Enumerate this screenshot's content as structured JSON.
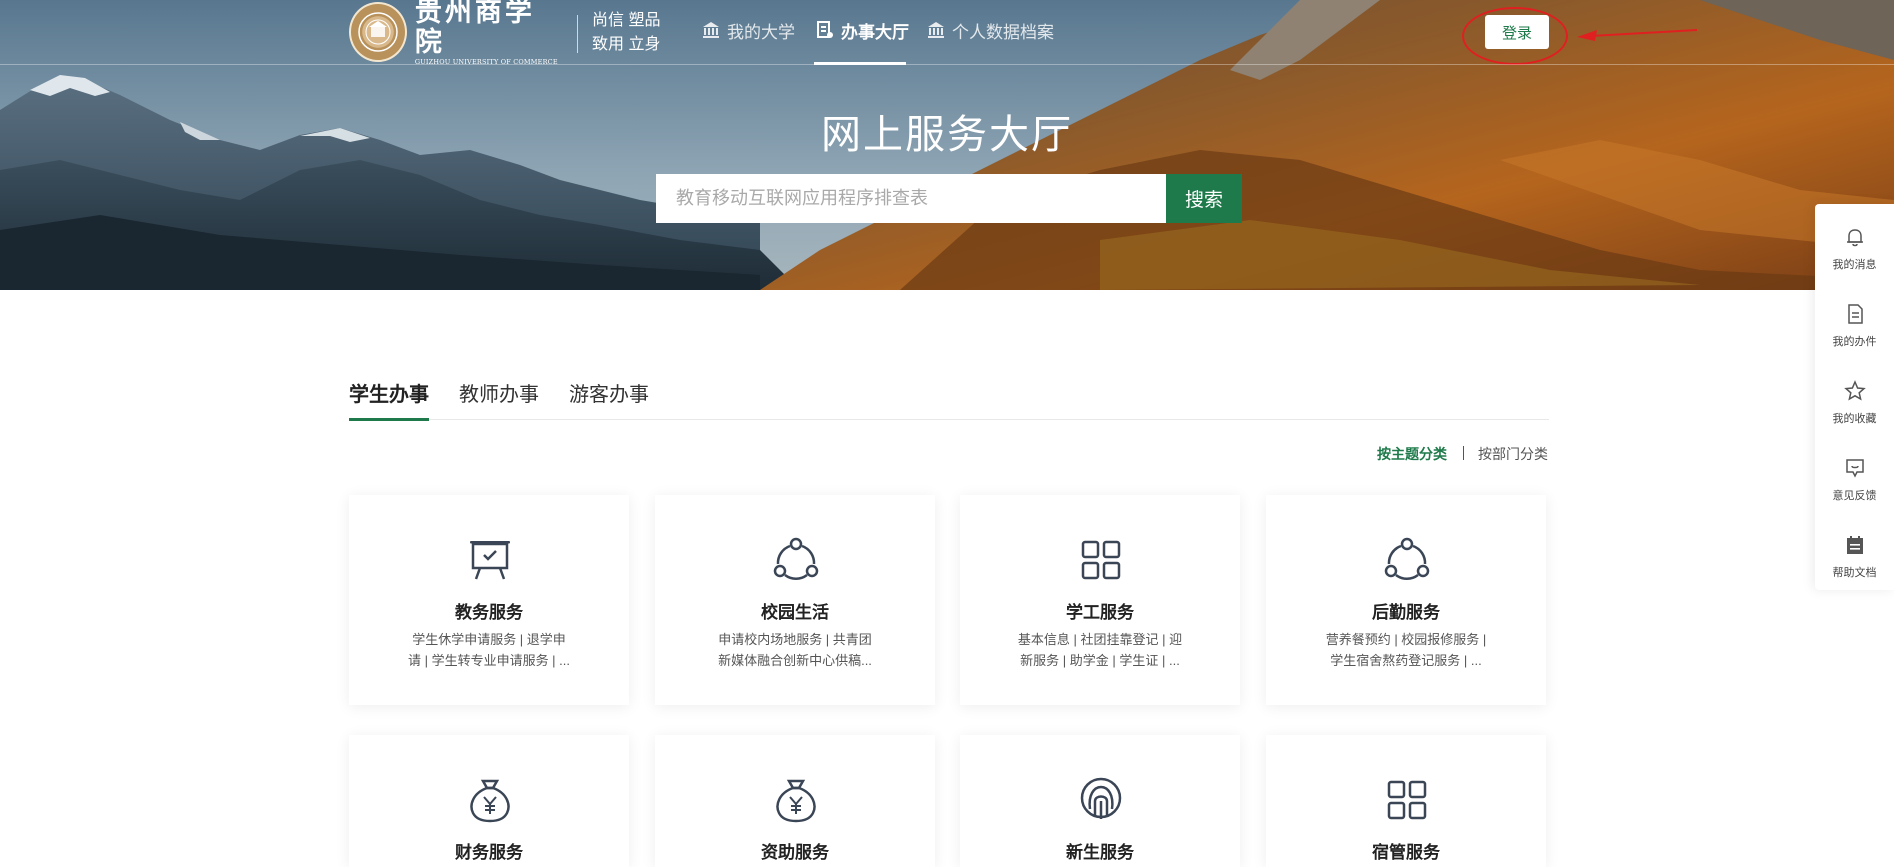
{
  "header": {
    "logo": {
      "name_cn": "贵州商学院",
      "name_en": "GUIZHOU UNIVERSITY OF COMMERCE"
    },
    "slogan": {
      "line1": "尚信 塑品",
      "line2": "致用 立身"
    },
    "nav": [
      {
        "label": "我的大学",
        "icon": "bank-icon",
        "active": false
      },
      {
        "label": "办事大厅",
        "icon": "service-doc-icon",
        "active": true
      },
      {
        "label": "个人数据档案",
        "icon": "bank-icon",
        "active": false
      }
    ],
    "login_label": "登录"
  },
  "hero": {
    "title": "网上服务大厅",
    "search_placeholder": "教育移动互联网应用程序排查表",
    "search_button": "搜索"
  },
  "tabs": [
    {
      "label": "学生办事",
      "active": true
    },
    {
      "label": "教师办事",
      "active": false
    },
    {
      "label": "游客办事",
      "active": false
    }
  ],
  "sort": {
    "by_topic": "按主题分类",
    "by_department": "按部门分类",
    "active": "by_topic"
  },
  "cards": [
    {
      "title": "教务服务",
      "icon": "presentation-board-icon",
      "desc_line1": "学生休学申请服务 | 退学申",
      "desc_line2": "请 | 学生转专业申请服务 | ..."
    },
    {
      "title": "校园生活",
      "icon": "share-network-icon",
      "desc_line1": "申请校内场地服务 | 共青团",
      "desc_line2": "新媒体融合创新中心供稿..."
    },
    {
      "title": "学工服务",
      "icon": "grid-apps-icon",
      "desc_line1": "基本信息 | 社团挂靠登记 | 迎",
      "desc_line2": "新服务 | 助学金 | 学生证 | ..."
    },
    {
      "title": "后勤服务",
      "icon": "share-network-icon",
      "desc_line1": "营养餐预约 | 校园报修服务 |",
      "desc_line2": "学生宿舍熬药登记服务 | ..."
    },
    {
      "title": "财务服务",
      "icon": "money-bag-icon",
      "desc_line1": "",
      "desc_line2": ""
    },
    {
      "title": "资助服务",
      "icon": "money-bag-icon",
      "desc_line1": "",
      "desc_line2": ""
    },
    {
      "title": "新生服务",
      "icon": "fingerprint-badge-icon",
      "desc_line1": "",
      "desc_line2": ""
    },
    {
      "title": "宿管服务",
      "icon": "grid-apps-icon",
      "desc_line1": "",
      "desc_line2": ""
    }
  ],
  "sidebar": [
    {
      "label": "我的消息",
      "icon": "bell-icon"
    },
    {
      "label": "我的办件",
      "icon": "document-icon"
    },
    {
      "label": "我的收藏",
      "icon": "star-icon"
    },
    {
      "label": "意见反馈",
      "icon": "feedback-icon"
    },
    {
      "label": "帮助文档",
      "icon": "calendar-doc-icon"
    }
  ],
  "colors": {
    "brand_green": "#1e7a4a",
    "annotation_red": "#e02020"
  }
}
